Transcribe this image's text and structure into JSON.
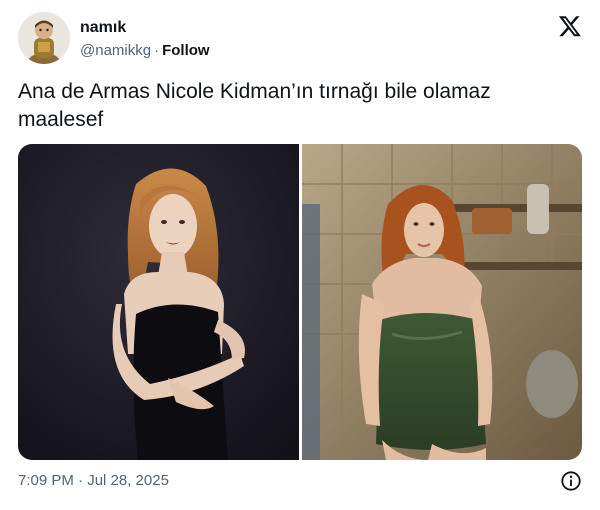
{
  "author": {
    "display_name": "namık",
    "handle": "@namikkg",
    "separator": "·",
    "follow_label": "Follow"
  },
  "tweet": {
    "text": "Ana de Armas Nicole Kidman’ın tırnağı bile olamaz maalesef"
  },
  "media": [
    {
      "name": "photo-left",
      "description": "studio portrait"
    },
    {
      "name": "photo-right",
      "description": "kitchen scene"
    }
  ],
  "footer": {
    "timestamp": "7:09 PM · Jul 28, 2025"
  },
  "icons": {
    "brand": "x-logo-icon",
    "info": "info-icon"
  },
  "colors": {
    "text": "#0f1419",
    "secondary": "#536471",
    "background": "#ffffff"
  }
}
